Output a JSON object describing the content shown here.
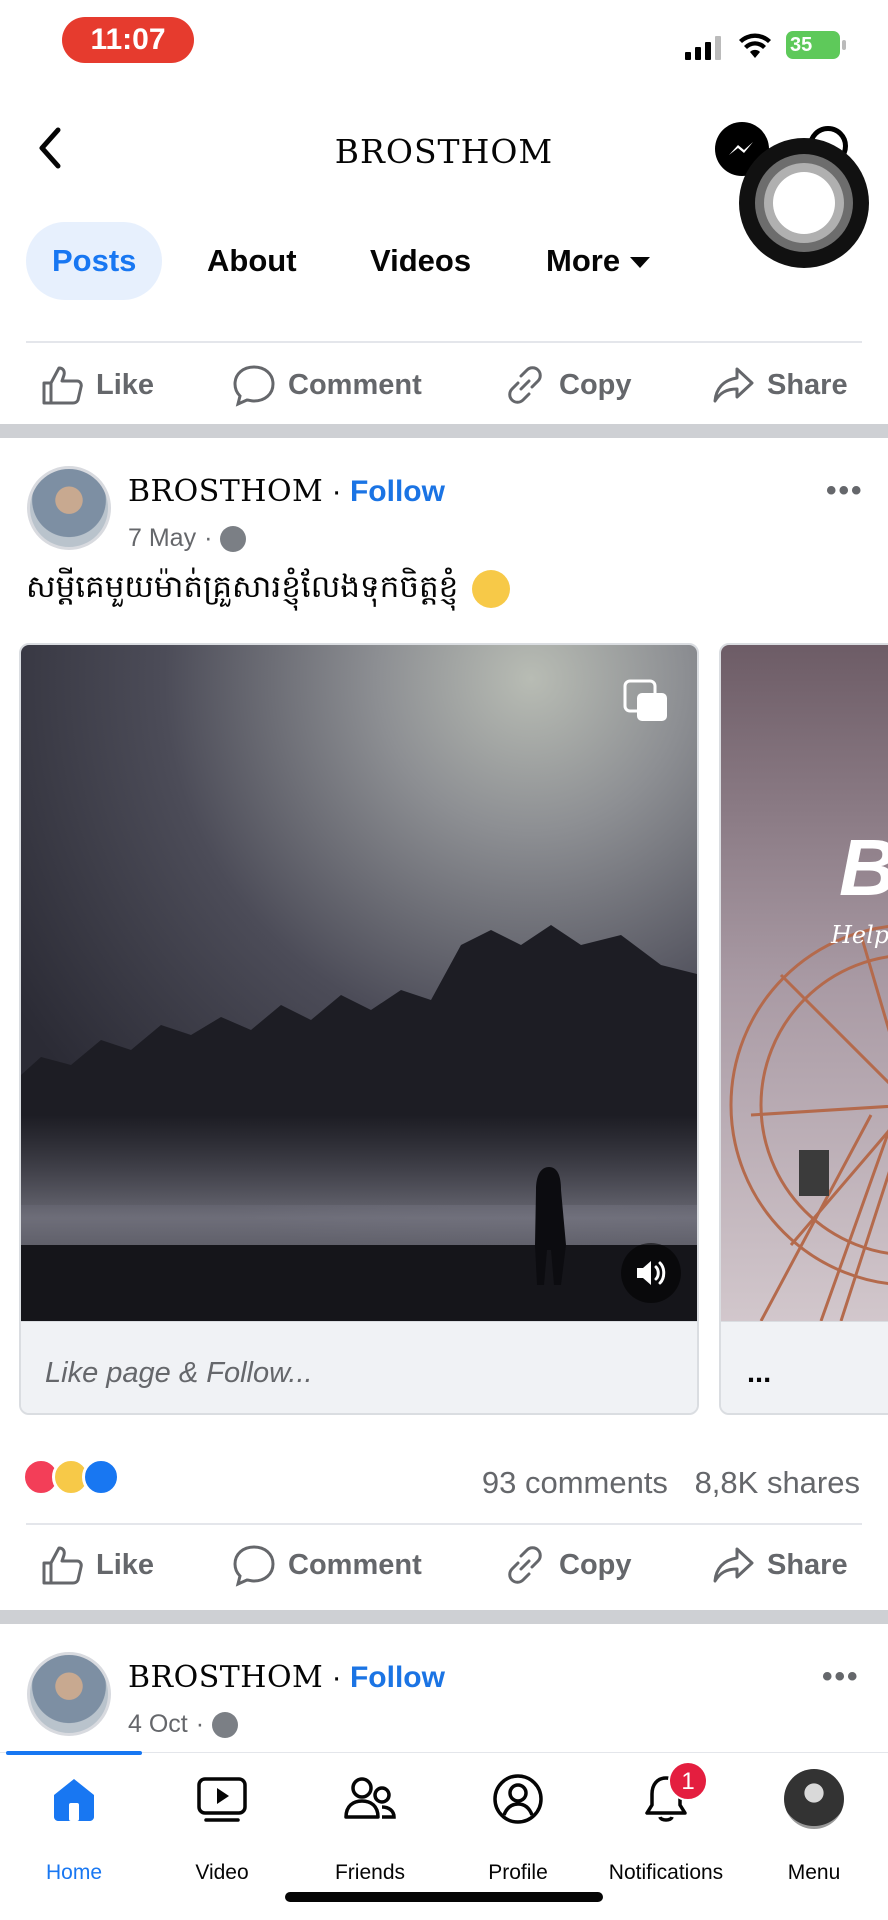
{
  "status_bar": {
    "time": "11:07",
    "battery": "35"
  },
  "header": {
    "title": "BROSTHOM"
  },
  "tabs": [
    {
      "label": "Posts"
    },
    {
      "label": "About"
    },
    {
      "label": "Videos"
    },
    {
      "label": "More"
    }
  ],
  "actions": {
    "like": "Like",
    "comment": "Comment",
    "copy": "Copy",
    "share": "Share"
  },
  "post1": {
    "author": "BROSTHOM",
    "separator": "·",
    "follow": "Follow",
    "date": "7 May",
    "text": "សម្តីគេមួយម៉ាត់គ្រួសារខ្ញុំលែងទុកចិត្តខ្ញុំ",
    "cards": [
      {
        "caption": "Like page & Follow..."
      },
      {
        "caption": "...",
        "overlay_text": "B",
        "overlay_sub": "Help L"
      }
    ],
    "comments": "93 comments",
    "shares": "8,8K shares"
  },
  "post2": {
    "author": "BROSTHOM",
    "separator": "·",
    "follow": "Follow",
    "date": "4 Oct"
  },
  "bottom_nav": [
    {
      "label": "Home",
      "icon": "home-icon"
    },
    {
      "label": "Video",
      "icon": "video-icon"
    },
    {
      "label": "Friends",
      "icon": "friends-icon"
    },
    {
      "label": "Profile",
      "icon": "profile-icon"
    },
    {
      "label": "Notifications",
      "icon": "bell-icon",
      "badge": "1"
    },
    {
      "label": "Menu",
      "icon": "menu-avatar"
    }
  ],
  "colors": {
    "accent": "#1877f2",
    "follow": "#1b74e4",
    "muted": "#65676b",
    "time_pill": "#e63b2e"
  }
}
